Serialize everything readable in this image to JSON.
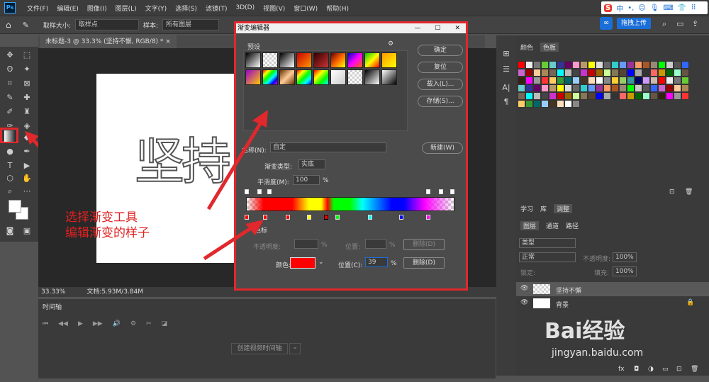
{
  "menu": {
    "items": [
      "文件(F)",
      "编辑(E)",
      "图像(I)",
      "图层(L)",
      "文字(Y)",
      "选择(S)",
      "滤镜(T)",
      "3D(D)",
      "视图(V)",
      "窗口(W)",
      "帮助(H)"
    ]
  },
  "optbar": {
    "sample_size_label": "取样大小:",
    "sample_size_value": "取样点",
    "sample_label": "样本:",
    "sample_value": "所有图层"
  },
  "doc_tab": {
    "label": "未标题-3 @ 33.3% (坚持不懈, RGB/8) *"
  },
  "canvas": {
    "text": "坚持"
  },
  "status": {
    "zoom": "33.33%",
    "doc": "文档:5.93M/3.84M"
  },
  "timeline": {
    "title": "时间轴",
    "create_button": "创建视频时间轴"
  },
  "annotation": {
    "line1": "选择渐变工具",
    "line2": "编辑渐变的样子"
  },
  "dialog": {
    "title": "渐变编辑器",
    "presets_label": "预设",
    "ok": "确定",
    "reset": "复位",
    "load": "载入(L)...",
    "save": "存储(S)...",
    "name_label": "名称(N):",
    "name_value": "自定",
    "new": "新建(W)",
    "type_label": "渐变类型:",
    "type_value": "实底",
    "smooth_label": "平滑度(M):",
    "smooth_value": "100",
    "smooth_unit": "%",
    "stops_label": "色标",
    "opacity_label": "不透明度:",
    "opacity_unit": "%",
    "position_label": "位置:",
    "position_unit": "%",
    "delete": "删除(D)",
    "color_label": "颜色:",
    "position_c_label": "位置(C):",
    "position_c_value": "39",
    "position_c_unit": "%",
    "delete2": "删除(D)",
    "color_value": "#ff0000"
  },
  "right_panel": {
    "tab_color": "颜色",
    "tab_swatches": "色板",
    "tab_learn": "学习",
    "tab_lib": "库",
    "tab_adjust": "调整",
    "tab_layers": "图层",
    "tab_channels": "通道",
    "tab_paths": "路径",
    "kind": "类型",
    "blend": "正常",
    "opacity_label": "不透明度:",
    "opacity_value": "100%",
    "lock_label": "锁定:",
    "fill_label": "填充:",
    "fill_value": "100%",
    "layers": [
      {
        "name": "坚持不懈"
      },
      {
        "name": "背景"
      }
    ]
  },
  "topright": {
    "btn": "拖拽上传"
  },
  "watermark": {
    "brand": "Bai经验",
    "url": "jingyan.baidu.com"
  }
}
